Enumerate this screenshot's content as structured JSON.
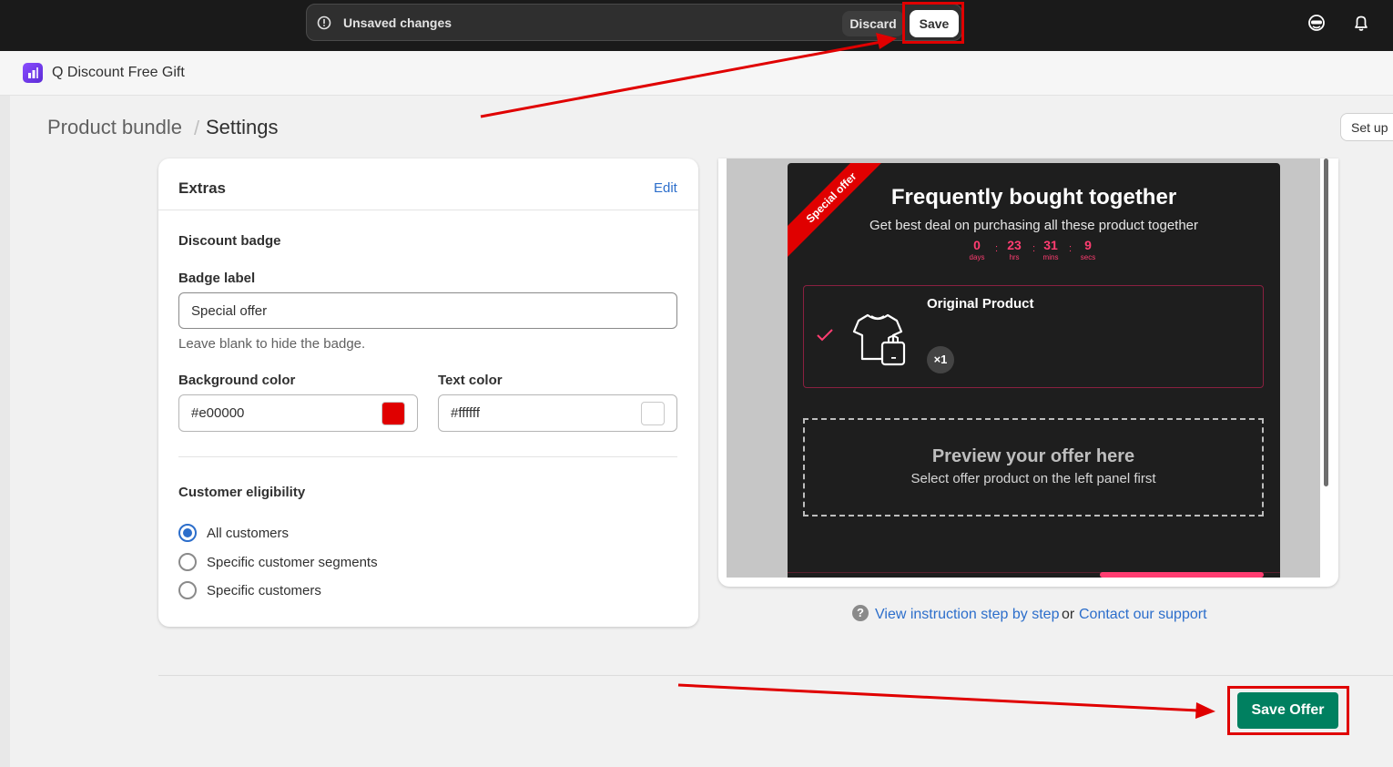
{
  "topbar": {
    "unsaved_text": "Unsaved changes",
    "discard_label": "Discard",
    "save_label": "Save"
  },
  "app": {
    "name": "Q Discount Free Gift"
  },
  "breadcrumb": {
    "parent": "Product bundle",
    "separator": "/",
    "current": "Settings"
  },
  "setup_button": "Set up",
  "extras": {
    "title": "Extras",
    "edit_label": "Edit",
    "discount_badge_title": "Discount badge",
    "badge_label_label": "Badge label",
    "badge_label_value": "Special offer",
    "badge_help": "Leave blank to hide the badge.",
    "bg_color_label": "Background color",
    "bg_color_value": "#e00000",
    "text_color_label": "Text color",
    "text_color_value": "#ffffff",
    "eligibility_title": "Customer eligibility",
    "eligibility_options": [
      {
        "label": "All customers",
        "checked": true
      },
      {
        "label": "Specific customer segments",
        "checked": false
      },
      {
        "label": "Specific customers",
        "checked": false
      }
    ]
  },
  "preview": {
    "ribbon": "Special offer",
    "title": "Frequently bought together",
    "subtitle": "Get best deal on purchasing all these product together",
    "countdown": [
      {
        "value": "0",
        "unit": "days"
      },
      {
        "value": "23",
        "unit": "hrs"
      },
      {
        "value": "31",
        "unit": "mins"
      },
      {
        "value": "9",
        "unit": "secs"
      }
    ],
    "countdown_sep": ":",
    "product_name": "Original Product",
    "product_qty": "×1",
    "offer_title": "Preview your offer here",
    "offer_sub": "Select offer product on the left panel first"
  },
  "help": {
    "icon": "?",
    "link1": "View instruction step by step",
    "or": "or",
    "link2": "Contact our support"
  },
  "footer": {
    "save_offer_label": "Save Offer"
  },
  "colors": {
    "primary_green": "#008060",
    "annotation_red": "#e00000",
    "link_blue": "#2c6ecb",
    "countdown_pink": "#ff3d71"
  }
}
